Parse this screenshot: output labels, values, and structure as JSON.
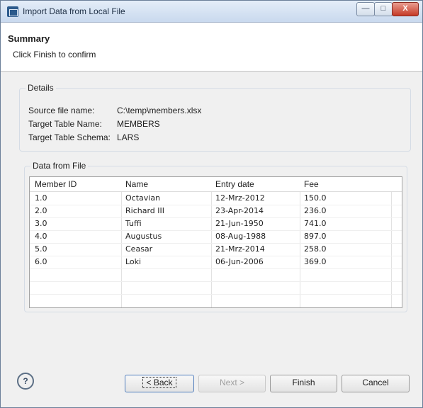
{
  "window": {
    "title": "Import Data from Local File",
    "buttons": {
      "minimize": "—",
      "maximize": "□",
      "close": "X"
    }
  },
  "banner": {
    "title": "Summary",
    "subtitle": "Click Finish to confirm"
  },
  "details": {
    "label": "Details",
    "items": [
      {
        "key": "Source file name:",
        "value": "C:\\temp\\members.xlsx"
      },
      {
        "key": "Target Table Name:",
        "value": "MEMBERS"
      },
      {
        "key": "Target Table Schema:",
        "value": "LARS"
      }
    ]
  },
  "data_from_file": {
    "label": "Data from File",
    "columns": [
      "Member ID",
      "Name",
      "Entry date",
      "Fee"
    ],
    "rows": [
      [
        "1.0",
        "Octavian",
        "12-Mrz-2012",
        "150.0"
      ],
      [
        "2.0",
        "Richard III",
        "23-Apr-2014",
        "236.0"
      ],
      [
        "3.0",
        "Tuffi",
        "21-Jun-1950",
        "741.0"
      ],
      [
        "4.0",
        "Augustus",
        "08-Aug-1988",
        "897.0"
      ],
      [
        "5.0",
        "Ceasar",
        "21-Mrz-2014",
        "258.0"
      ],
      [
        "6.0",
        "Loki",
        "06-Jun-2006",
        "369.0"
      ]
    ]
  },
  "buttons": {
    "help": "?",
    "back": "< Back",
    "next": "Next >",
    "finish": "Finish",
    "cancel": "Cancel"
  }
}
